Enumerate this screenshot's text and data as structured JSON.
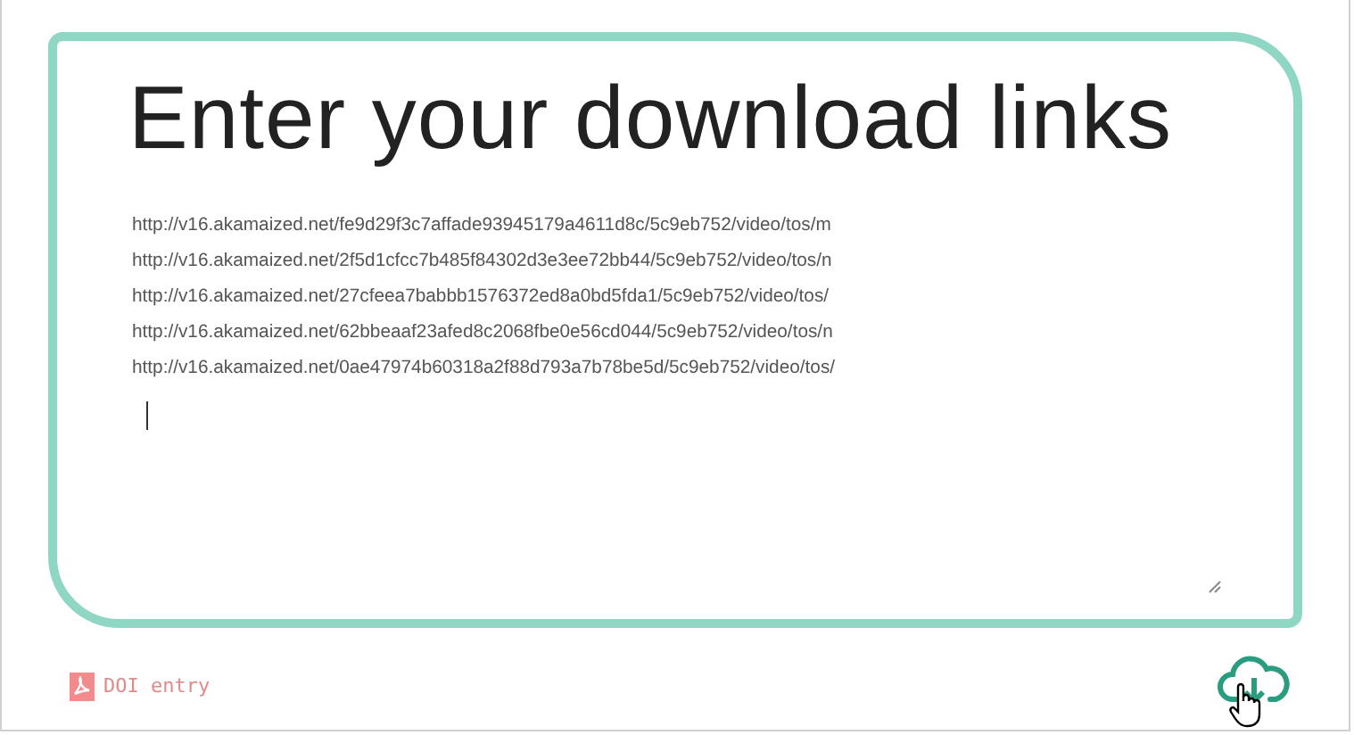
{
  "heading": "Enter your download links",
  "links": [
    "http://v16.akamaized.net/fe9d29f3c7affade93945179a4611d8c/5c9eb752/video/tos/m",
    "http://v16.akamaized.net/2f5d1cfcc7b485f84302d3e3ee72bb44/5c9eb752/video/tos/n",
    "http://v16.akamaized.net/27cfeea7babbb1576372ed8a0bd5fda1/5c9eb752/video/tos/",
    "http://v16.akamaized.net/62bbeaaf23afed8c2068fbe0e56cd044/5c9eb752/video/tos/n",
    "http://v16.akamaized.net/0ae47974b60318a2f88d793a7b78be5d/5c9eb752/video/tos/"
  ],
  "doi_link": "DOI entry"
}
